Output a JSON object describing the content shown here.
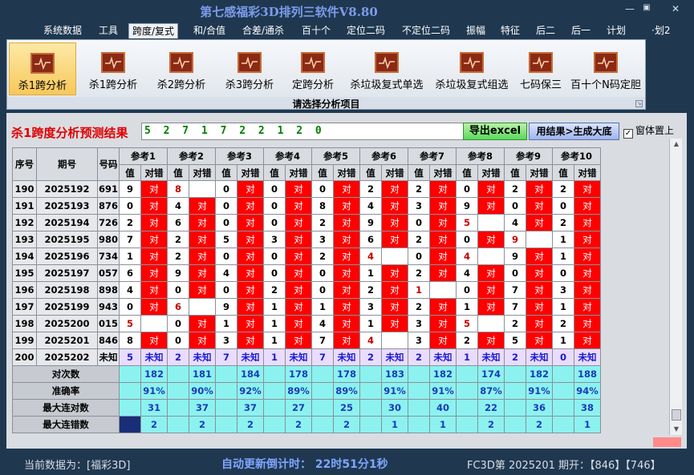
{
  "app_title": "第七感福彩3D排列三软件V8.80",
  "window_buttons": [
    "—",
    "▣",
    "✕"
  ],
  "menu": [
    "系统数据",
    "工具",
    "跨度/复式",
    "和/合值",
    "合差/通杀",
    "百十个",
    "定位二码",
    "不定位二码",
    "振幅",
    "特征",
    "后二",
    "后一",
    "计划",
    "·划2"
  ],
  "ribbon": {
    "buttons": [
      "杀1跨分析",
      "杀1跨分析",
      "杀2跨分析",
      "杀3跨分析",
      "定跨分析",
      "杀垃圾复式单选",
      "杀垃圾复式组选",
      "七码保三",
      "百十个N码定胆"
    ],
    "caption": "请选择分析项目",
    "corner": "↘"
  },
  "result": {
    "label": "杀1跨度分析预测结果",
    "value": "5 2 7 1 7 2 2 1 2 0",
    "excel_btn": "导出excel",
    "gen_btn": "用结果>生成大底",
    "topmost_check": "✓",
    "topmost_label": "窗体置上"
  },
  "table": {
    "headers": {
      "seq": "序号",
      "period": "期号",
      "code": "号码",
      "val": "值",
      "dz": "对错"
    },
    "refs": [
      "参考1",
      "参考2",
      "参考3",
      "参考4",
      "参考5",
      "参考6",
      "参考7",
      "参考8",
      "参考9",
      "参考10"
    ],
    "hit_text": "对",
    "unk_text": "未知",
    "rows": [
      {
        "seq": "190",
        "period": "2025192",
        "code": "691",
        "vals": [
          "9",
          "8",
          "0",
          "0",
          "0",
          "2",
          "2",
          "0",
          "2",
          "2"
        ],
        "hits": [
          1,
          0,
          1,
          1,
          1,
          1,
          1,
          1,
          1,
          1
        ],
        "big": [
          0,
          1,
          0,
          0,
          0,
          0,
          0,
          0,
          0,
          0
        ]
      },
      {
        "seq": "191",
        "period": "2025193",
        "code": "876",
        "vals": [
          "0",
          "4",
          "0",
          "0",
          "8",
          "4",
          "3",
          "9",
          "0",
          "0"
        ],
        "hits": [
          1,
          1,
          1,
          1,
          1,
          1,
          1,
          1,
          1,
          1
        ],
        "big": [
          0,
          0,
          0,
          0,
          0,
          0,
          0,
          0,
          0,
          0
        ]
      },
      {
        "seq": "192",
        "period": "2025194",
        "code": "726",
        "vals": [
          "2",
          "6",
          "0",
          "0",
          "2",
          "9",
          "0",
          "5",
          "4",
          "2"
        ],
        "hits": [
          1,
          1,
          1,
          1,
          1,
          1,
          1,
          0,
          1,
          1
        ],
        "big": [
          0,
          0,
          0,
          0,
          0,
          0,
          0,
          1,
          0,
          0
        ]
      },
      {
        "seq": "193",
        "period": "2025195",
        "code": "980",
        "vals": [
          "7",
          "2",
          "5",
          "3",
          "3",
          "6",
          "2",
          "0",
          "9",
          "1"
        ],
        "hits": [
          1,
          1,
          1,
          1,
          1,
          1,
          1,
          1,
          0,
          1
        ],
        "big": [
          0,
          0,
          0,
          0,
          0,
          0,
          0,
          0,
          1,
          0
        ]
      },
      {
        "seq": "194",
        "period": "2025196",
        "code": "734",
        "vals": [
          "1",
          "2",
          "0",
          "0",
          "2",
          "4",
          "0",
          "4",
          "9",
          "1"
        ],
        "hits": [
          1,
          1,
          1,
          1,
          1,
          0,
          1,
          0,
          1,
          1
        ],
        "big": [
          0,
          0,
          0,
          0,
          0,
          1,
          0,
          1,
          0,
          0
        ]
      },
      {
        "seq": "195",
        "period": "2025197",
        "code": "057",
        "vals": [
          "6",
          "9",
          "4",
          "0",
          "0",
          "1",
          "2",
          "4",
          "0",
          "0"
        ],
        "hits": [
          1,
          1,
          1,
          1,
          1,
          1,
          1,
          1,
          1,
          1
        ],
        "big": [
          0,
          0,
          0,
          0,
          0,
          0,
          0,
          0,
          0,
          0
        ]
      },
      {
        "seq": "196",
        "period": "2025198",
        "code": "898",
        "vals": [
          "4",
          "0",
          "0",
          "2",
          "0",
          "2",
          "1",
          "0",
          "7",
          "3"
        ],
        "hits": [
          1,
          1,
          1,
          1,
          1,
          1,
          0,
          1,
          1,
          1
        ],
        "big": [
          0,
          0,
          0,
          0,
          0,
          0,
          1,
          0,
          0,
          0
        ]
      },
      {
        "seq": "197",
        "period": "2025199",
        "code": "943",
        "vals": [
          "0",
          "6",
          "9",
          "1",
          "1",
          "3",
          "2",
          "1",
          "7",
          "1"
        ],
        "hits": [
          1,
          0,
          1,
          1,
          1,
          1,
          1,
          1,
          1,
          1
        ],
        "big": [
          0,
          1,
          0,
          0,
          0,
          0,
          0,
          0,
          0,
          0
        ]
      },
      {
        "seq": "198",
        "period": "2025200",
        "code": "015",
        "vals": [
          "5",
          "0",
          "1",
          "1",
          "4",
          "1",
          "3",
          "5",
          "2",
          "2"
        ],
        "hits": [
          0,
          1,
          1,
          1,
          1,
          1,
          1,
          0,
          1,
          1
        ],
        "big": [
          1,
          0,
          0,
          0,
          0,
          0,
          0,
          1,
          0,
          0
        ]
      },
      {
        "seq": "199",
        "period": "2025201",
        "code": "846",
        "vals": [
          "8",
          "0",
          "3",
          "1",
          "7",
          "4",
          "3",
          "2",
          "5",
          "1"
        ],
        "hits": [
          1,
          1,
          1,
          1,
          1,
          0,
          1,
          1,
          1,
          1
        ],
        "big": [
          0,
          0,
          0,
          0,
          0,
          1,
          0,
          0,
          0,
          0
        ]
      }
    ],
    "pending": {
      "seq": "200",
      "period": "2025202",
      "code": "未知",
      "vals": [
        "5",
        "2",
        "7",
        "1",
        "7",
        "2",
        "2",
        "1",
        "2",
        "0"
      ]
    },
    "stats": [
      {
        "label": "对次数",
        "values": [
          "182",
          "181",
          "184",
          "178",
          "178",
          "183",
          "182",
          "174",
          "182",
          "188"
        ]
      },
      {
        "label": "准确率",
        "values": [
          "91%",
          "90%",
          "92%",
          "89%",
          "89%",
          "91%",
          "91%",
          "87%",
          "91%",
          "94%"
        ]
      },
      {
        "label": "最大连对数",
        "values": [
          "31",
          "37",
          "37",
          "27",
          "25",
          "30",
          "40",
          "22",
          "36",
          "38"
        ]
      },
      {
        "label": "最大连错数",
        "values": [
          "2",
          "2",
          "2",
          "2",
          "2",
          "1",
          "1",
          "2",
          "2",
          "1"
        ]
      }
    ]
  },
  "status": {
    "left": "当前数据为：[福彩3D]",
    "center": "自动更新倒计时： 22时51分1秒",
    "right": "FC3D第 2025201 期开：【846】【746】"
  },
  "colors": {
    "hit": "#ff0000",
    "stat_bg": "#8cf2f0",
    "unknown_bg": "#eadcff",
    "title": "#7d9bea"
  }
}
